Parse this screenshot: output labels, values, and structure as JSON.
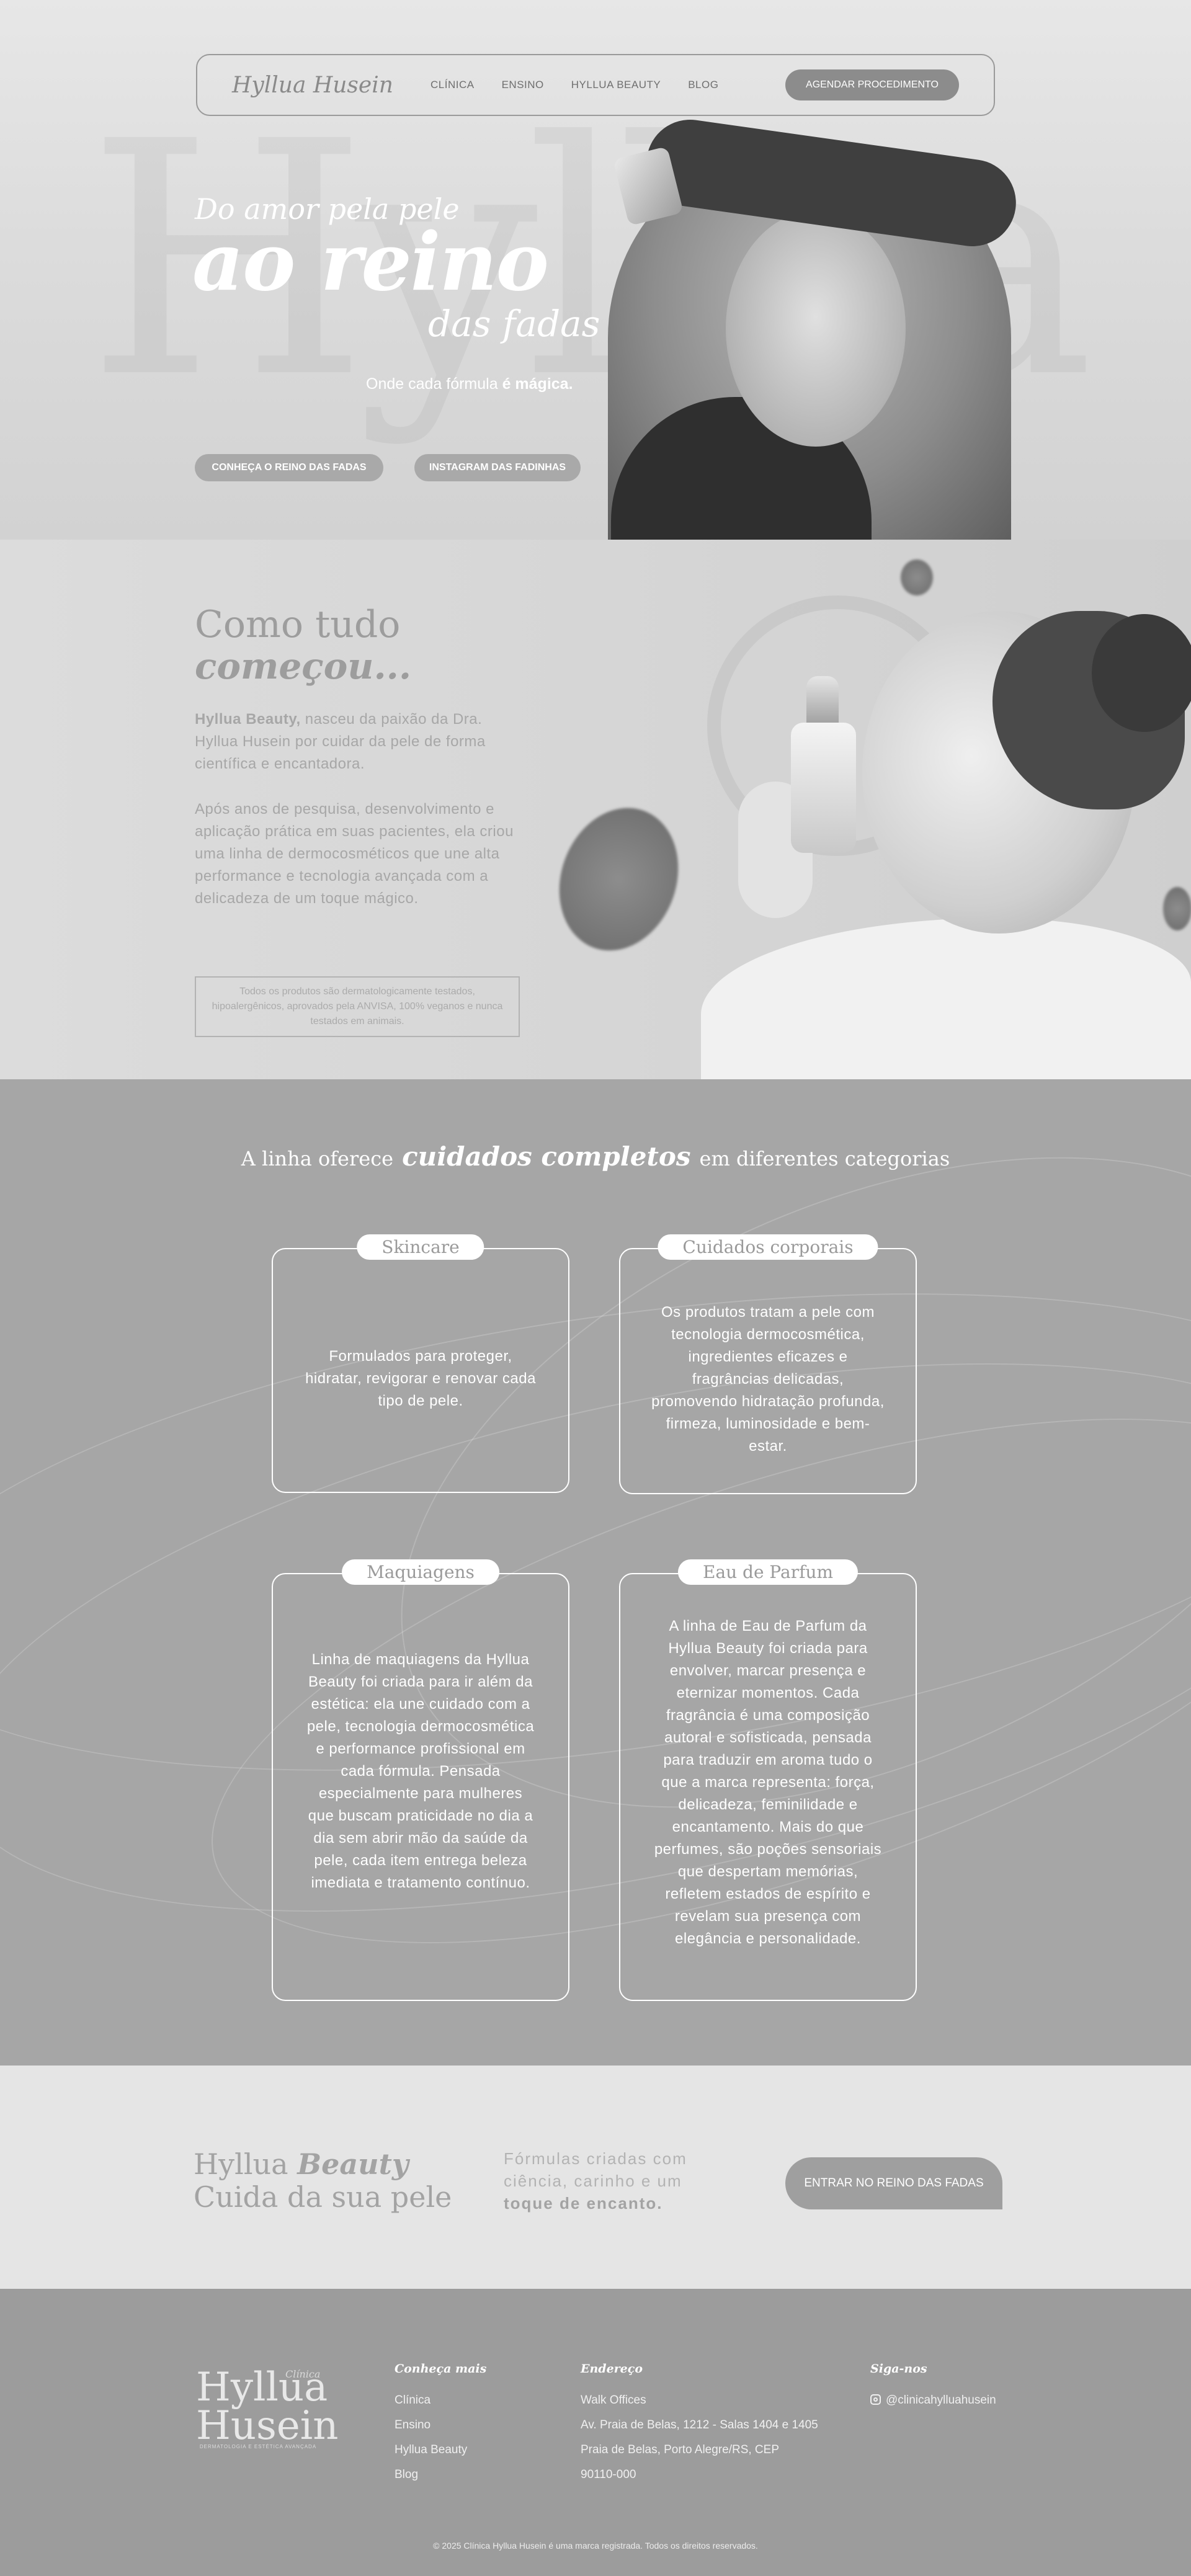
{
  "header": {
    "logo": "Hyllua Husein",
    "nav": [
      "CLÍNICA",
      "ENSINO",
      "HYLLUA BEAUTY",
      "BLOG"
    ],
    "cta": "AGENDAR PROCEDIMENTO"
  },
  "hero": {
    "watermark": "Hyllua",
    "watermark_small": "Y",
    "line1": "Do amor pela pele",
    "line2": "ao reino",
    "line3": "das fadas",
    "subtitle": "Onde cada fórmula",
    "subtitle_bold": "é mágica.",
    "btn_primary": "CONHEÇA O REINO DAS FADAS",
    "btn_secondary": "INSTAGRAM DAS FADINHAS"
  },
  "story": {
    "title1": "Como tudo",
    "title2": "começou...",
    "p1_bold": "Hyllua Beauty,",
    "p1": " nasceu da paixão da Dra. Hyllua Husein por cuidar da pele de forma científica e encantadora.",
    "p2": "Após anos de pesquisa, desenvolvimento e aplicação prática em suas pacientes, ela criou uma linha de dermocosméticos que une alta performance e tecnologia avançada com a delicadeza de um toque mágico.",
    "note": "Todos os produtos são dermatologicamente testados, hipoalergênicos, aprovados pela ANVISA, 100% veganos e nunca testados em animais."
  },
  "categories": {
    "title_pre": "A linha oferece",
    "title_em": "cuidados completos",
    "title_post": "em diferentes categorias",
    "cards": [
      {
        "label": "Skincare",
        "text": "Formulados para proteger, hidratar, revigorar e renovar cada tipo de pele."
      },
      {
        "label": "Cuidados corporais",
        "text": "Os produtos tratam a pele com tecnologia dermocosmética, ingredientes eficazes e fragrâncias delicadas, promovendo hidratação profunda, firmeza, luminosidade e bem-estar."
      },
      {
        "label": "Maquiagens",
        "text": "Linha de maquiagens da Hyllua Beauty foi criada para ir além da estética: ela une cuidado com a pele, tecnologia dermocosmética e performance profissional em cada fórmula. Pensada especialmente para mulheres que buscam praticidade no dia a dia sem abrir mão da saúde da pele, cada item entrega beleza imediata e tratamento contínuo."
      },
      {
        "label": "Eau de Parfum",
        "text": "A linha de Eau de Parfum da Hyllua Beauty foi criada para envolver, marcar presença e eternizar momentos. Cada fragrância é uma composição autoral e sofisticada, pensada para traduzir em aroma tudo o que a marca representa: força, delicadeza, feminilidade e encantamento. Mais do que perfumes, são poções sensoriais que despertam memórias, refletem estados de espírito e revelam sua presença com elegância e personalidade."
      }
    ]
  },
  "cta": {
    "line1_pre": "Hyllua ",
    "line1_em": "Beauty",
    "line2": "Cuida da sua pele",
    "text": "Fórmulas criadas com ciência, carinho e um ",
    "text_bold": "toque de encanto.",
    "button": "ENTRAR NO REINO DAS FADAS"
  },
  "footer": {
    "logo_top": "Clínica",
    "logo_line1": "Hyllua",
    "logo_line2": "Husein",
    "logo_tag": "DERMATOLOGIA E ESTÉTICA AVANÇADA",
    "col1_title": "Conheça mais",
    "col1_items": [
      "Clínica",
      "Ensino",
      "Hyllua Beauty",
      "Blog"
    ],
    "col2_title": "Endereço",
    "col2_lines": [
      "Walk Offices",
      "Av. Praia de Belas, 1212 - Salas 1404 e 1405",
      "Praia de Belas, Porto Alegre/RS, CEP",
      "90110-000"
    ],
    "col3_title": "Siga-nos",
    "instagram": "@clinicahylluahusein",
    "copyright": "© 2025 Clínica Hyllua Husein é uma marca registrada. Todos os direitos reservados."
  }
}
